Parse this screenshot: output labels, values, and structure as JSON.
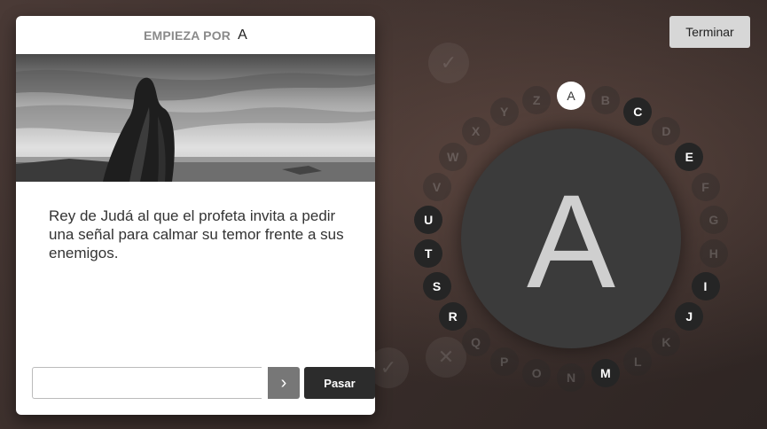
{
  "header": {
    "finish_label": "Terminar"
  },
  "card": {
    "starts_with_label": "EMPIEZA POR",
    "starts_with_letter": "A",
    "question": "Rey de Judá al que el profeta invita a pedir una señal para calmar su temor frente a sus enemigos.",
    "answer": {
      "value": "",
      "placeholder": ""
    },
    "go_glyph": "›",
    "skip_label": "Pasar"
  },
  "wheel": {
    "current_letter": "A",
    "letters": [
      {
        "letter": "A",
        "state": "current"
      },
      {
        "letter": "B",
        "state": "dim"
      },
      {
        "letter": "C",
        "state": "dark"
      },
      {
        "letter": "D",
        "state": "dim"
      },
      {
        "letter": "E",
        "state": "dark"
      },
      {
        "letter": "F",
        "state": "dim"
      },
      {
        "letter": "G",
        "state": "dim"
      },
      {
        "letter": "H",
        "state": "dim"
      },
      {
        "letter": "I",
        "state": "dark"
      },
      {
        "letter": "J",
        "state": "dark"
      },
      {
        "letter": "K",
        "state": "dim"
      },
      {
        "letter": "L",
        "state": "dim"
      },
      {
        "letter": "M",
        "state": "dark"
      },
      {
        "letter": "N",
        "state": "dim"
      },
      {
        "letter": "O",
        "state": "dim"
      },
      {
        "letter": "P",
        "state": "dim"
      },
      {
        "letter": "Q",
        "state": "dim"
      },
      {
        "letter": "R",
        "state": "dark"
      },
      {
        "letter": "S",
        "state": "dark"
      },
      {
        "letter": "T",
        "state": "dark"
      },
      {
        "letter": "U",
        "state": "dark"
      },
      {
        "letter": "V",
        "state": "dim"
      },
      {
        "letter": "W",
        "state": "dim"
      },
      {
        "letter": "X",
        "state": "dim"
      },
      {
        "letter": "Y",
        "state": "dim"
      },
      {
        "letter": "Z",
        "state": "dim"
      }
    ]
  },
  "icons": {
    "check": "check-icon",
    "cross": "cross-icon",
    "go": "chevron-right-icon"
  }
}
